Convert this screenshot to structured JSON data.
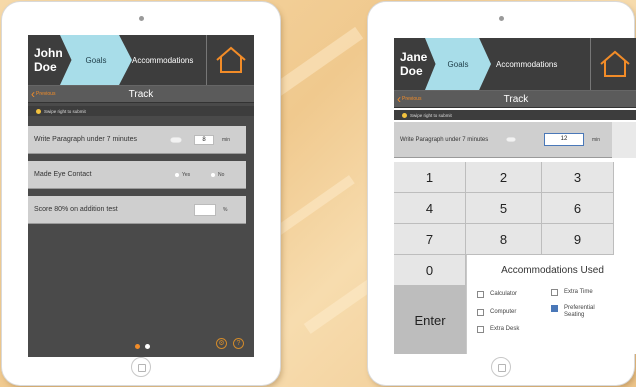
{
  "left": {
    "student": {
      "first": "John",
      "last": "Doe"
    },
    "nav": {
      "goals": "Goals",
      "accommodations": "Accommodations"
    },
    "track": {
      "previous": "Previous",
      "title": "Track"
    },
    "swipe_hint": "Swipe right to submit",
    "goals": [
      {
        "label": "Write Paragraph under 7 minutes",
        "value": "8",
        "unit": "min"
      },
      {
        "label": "Made Eye Contact",
        "yes": "Yes",
        "no": "No"
      },
      {
        "label": "Score 80% on addition test",
        "value": "",
        "unit": "%"
      }
    ],
    "page_indicator": {
      "pages": 2,
      "current": 1
    }
  },
  "right": {
    "student": {
      "first": "Jane",
      "last": "Doe"
    },
    "nav": {
      "goals": "Goals",
      "accommodations": "Accommodations"
    },
    "track": {
      "previous": "Previous",
      "title": "Track"
    },
    "swipe_hint": "Swipe right to submit",
    "goal": {
      "label": "Write Paragraph under 7 minutes",
      "value": "12",
      "unit": "min"
    },
    "keypad": [
      "1",
      "2",
      "3",
      "4",
      "5",
      "6",
      "7",
      "8",
      "9",
      "0"
    ],
    "enter_label": "Enter",
    "accommodations": {
      "title": "Accommodations Used",
      "items": [
        {
          "label": "Calculator",
          "checked": false
        },
        {
          "label": "Computer",
          "checked": false
        },
        {
          "label": "Extra Desk",
          "checked": false
        },
        {
          "label": "Extra Time",
          "checked": false
        },
        {
          "label": "Preferential Seating",
          "checked": true
        }
      ]
    }
  },
  "colors": {
    "accent": "#f28c28",
    "goals_tab": "#a8dde9",
    "background": "#f3d19c"
  }
}
